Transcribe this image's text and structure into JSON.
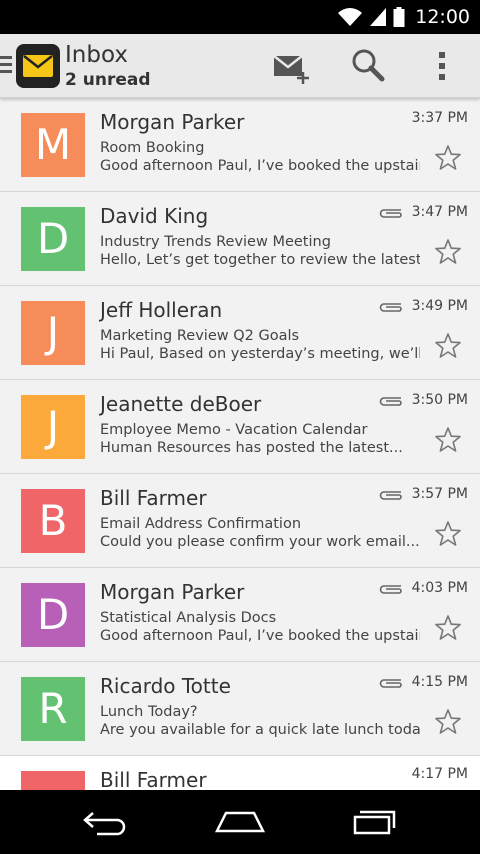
{
  "status_bar": {
    "time": "12:00"
  },
  "action_bar": {
    "title": "Inbox",
    "subtitle": "2 unread",
    "compose_icon": "compose-mail-icon",
    "search_icon": "search-icon",
    "overflow_icon": "overflow-menu-icon"
  },
  "colors": {
    "orange": "#f58c5a",
    "green": "#63c172",
    "amber": "#fba93a",
    "red": "#f06568",
    "purple": "#b85fb7"
  },
  "messages": [
    {
      "initial": "M",
      "color": "#f58c5a",
      "sender": "Morgan Parker",
      "subject": "Room Booking",
      "preview": "Good afternoon Paul, I’ve booked the upstairs...",
      "time": "3:37 PM",
      "attachment": false
    },
    {
      "initial": "D",
      "color": "#63c172",
      "sender": "David King",
      "subject": "Industry Trends Review Meeting",
      "preview": "Hello, Let’s get together to review the latest...",
      "time": "3:47 PM",
      "attachment": true
    },
    {
      "initial": "J",
      "color": "#f58c5a",
      "sender": "Jeff Holleran",
      "subject": "Marketing Review Q2 Goals",
      "preview": "Hi Paul, Based on yesterday’s meeting, we’ll...",
      "time": "3:49 PM",
      "attachment": true
    },
    {
      "initial": "J",
      "color": "#fba93a",
      "sender": "Jeanette deBoer",
      "subject": "Employee Memo - Vacation Calendar",
      "preview": "Human Resources has posted the latest...",
      "time": "3:50 PM",
      "attachment": true
    },
    {
      "initial": "B",
      "color": "#f06568",
      "sender": "Bill Farmer",
      "subject": "Email Address Confirmation",
      "preview": "Could you please confirm your work email...",
      "time": "3:57 PM",
      "attachment": true
    },
    {
      "initial": "D",
      "color": "#b85fb7",
      "sender": "Morgan Parker",
      "subject": "Statistical Analysis Docs",
      "preview": "Good afternoon Paul, I’ve booked the upstairs",
      "time": "4:03 PM",
      "attachment": true
    },
    {
      "initial": "R",
      "color": "#63c172",
      "sender": "Ricardo Totte",
      "subject": "Lunch Today?",
      "preview": "Are you available for a quick late lunch today?",
      "time": "4:15 PM",
      "attachment": true
    },
    {
      "initial": "",
      "color": "#f06568",
      "sender": "Bill Farmer",
      "subject": "",
      "preview": "",
      "time": "4:17 PM",
      "attachment": false
    }
  ]
}
